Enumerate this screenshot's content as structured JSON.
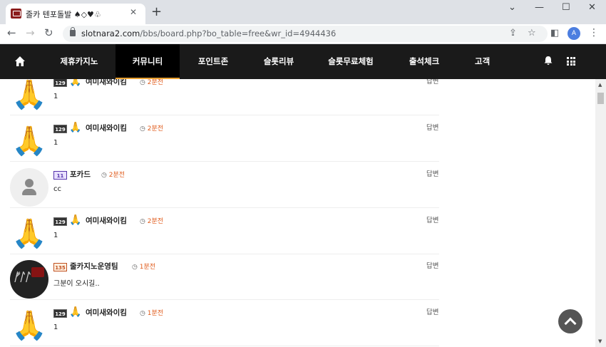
{
  "browser": {
    "tab_title": "줄카 텐포돌발 ♠◇♥♧",
    "tab_close": "✕",
    "new_tab": "+",
    "win_min": "⌄",
    "win_minimize": "—",
    "win_max": "☐",
    "win_close": "✕",
    "back": "←",
    "forward": "→",
    "reload": "↻",
    "url_host": "slotnara2.com",
    "url_path": "/bbs/board.php?bo_table=free&wr_id=4944436",
    "share": "⇪",
    "star": "☆",
    "panel": "◧",
    "profile": "A",
    "menu": "⋮"
  },
  "site_nav": {
    "items": [
      {
        "label": "제휴카지노"
      },
      {
        "label": "커뮤니티"
      },
      {
        "label": "포인트존"
      },
      {
        "label": "슬롯리뷰"
      },
      {
        "label": "슬롯무료체험"
      },
      {
        "label": "출석체크"
      },
      {
        "label": "고객센"
      }
    ]
  },
  "comments": [
    {
      "level": "129",
      "emoji": "🙏",
      "nick": "여미새와이킴",
      "time": "2분전",
      "reply": "답변",
      "body": "1",
      "avatar": "🙏"
    },
    {
      "level": "129",
      "emoji": "🙏",
      "nick": "여미새와이킴",
      "time": "2분전",
      "reply": "답변",
      "body": "1",
      "avatar": "🙏"
    },
    {
      "level": "11",
      "emoji": "",
      "nick": "포카드",
      "time": "2분전",
      "reply": "답변",
      "body": "cc",
      "avatar": ""
    },
    {
      "level": "129",
      "emoji": "🙏",
      "nick": "여미새와이킴",
      "time": "2분전",
      "reply": "답변",
      "body": "1",
      "avatar": "🙏"
    },
    {
      "level": "135",
      "emoji": "",
      "nick": "줄카지노운영팀",
      "time": "1분전",
      "reply": "답변",
      "body": "그분이 오시길..",
      "avatar": ""
    },
    {
      "level": "129",
      "emoji": "🙏",
      "nick": "여미새와이킴",
      "time": "1분전",
      "reply": "답변",
      "body": "1",
      "avatar": "🙏"
    }
  ],
  "scroll": {
    "up": "▲",
    "down": "▼"
  }
}
